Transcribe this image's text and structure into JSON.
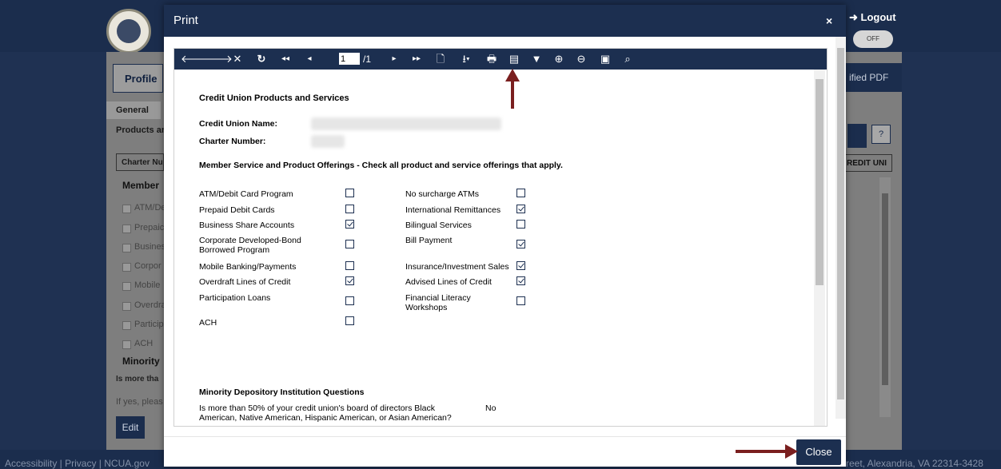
{
  "background": {
    "logout_label": "Logout",
    "toggle_label": "OFF",
    "profile_tab": "Profile",
    "general_tab": "General",
    "products_label": "Products ar",
    "charter_col": "Charter Nu",
    "member_heading": "Member",
    "list_items": [
      "ATM/De",
      "Prepaic",
      "Busines",
      "Corpor",
      "Mobile",
      "Overdra",
      "Particip",
      "ACH"
    ],
    "minority_heading": "Minority",
    "is_more": "Is more tha",
    "if_yes": "If yes, pleas",
    "edit_button": "Edit",
    "certified_pdf": "ified PDF",
    "help_icon": "?",
    "credit_col": "REDIT UNI",
    "footer_left": "Accessibility | Privacy | NCUA.gov",
    "footer_right": "reet, Alexandria, VA 22314-3428"
  },
  "modal": {
    "title": "Print",
    "close_x": "×",
    "close_button": "Close"
  },
  "toolbar": {
    "page_value": "1",
    "page_of": "/1",
    "icons": [
      "back-icon",
      "forward-icon",
      "stop-icon",
      "refresh-icon",
      "first-page-icon",
      "previous-page-icon",
      "next-page-icon",
      "last-page-icon",
      "page-setup-icon",
      "export-icon",
      "print-icon",
      "print-layout-icon",
      "filter-icon",
      "zoom-in-icon",
      "zoom-out-icon",
      "view-icon",
      "search-icon"
    ]
  },
  "report": {
    "title": "Credit Union Products and Services",
    "cu_name_label": "Credit Union Name:",
    "charter_label": "Charter Number:",
    "offerings_heading": "Member Service and Product Offerings - Check all product and service offerings that apply.",
    "left_items": [
      {
        "label": "ATM/Debit Card Program",
        "checked": false
      },
      {
        "label": "Prepaid Debit Cards",
        "checked": false
      },
      {
        "label": "Business Share Accounts",
        "checked": true
      },
      {
        "label": "Corporate Developed-Bond Borrowed Program",
        "checked": false
      },
      {
        "label": "Mobile Banking/Payments",
        "checked": false
      },
      {
        "label": "Overdraft Lines of Credit",
        "checked": true
      },
      {
        "label": "Participation Loans",
        "checked": false
      },
      {
        "label": "ACH",
        "checked": false
      }
    ],
    "right_items": [
      {
        "label": "No surcharge ATMs",
        "checked": false
      },
      {
        "label": "International Remittances",
        "checked": true
      },
      {
        "label": "Bilingual Services",
        "checked": false
      },
      {
        "label": "Bill Payment",
        "checked": true
      },
      {
        "label": "Insurance/Investment Sales",
        "checked": true
      },
      {
        "label": "Advised Lines of Credit",
        "checked": true
      },
      {
        "label": "Financial Literacy Workshops",
        "checked": false
      }
    ],
    "minority_heading": "Minority Depository Institution Questions",
    "minority_question": "Is more than 50% of your credit union's board of directors Black American, Native American, Hispanic American, or Asian American?",
    "minority_answer": "No"
  },
  "colors": {
    "navy": "#1c2f50",
    "annotation_arrow": "#7a1f1f"
  }
}
